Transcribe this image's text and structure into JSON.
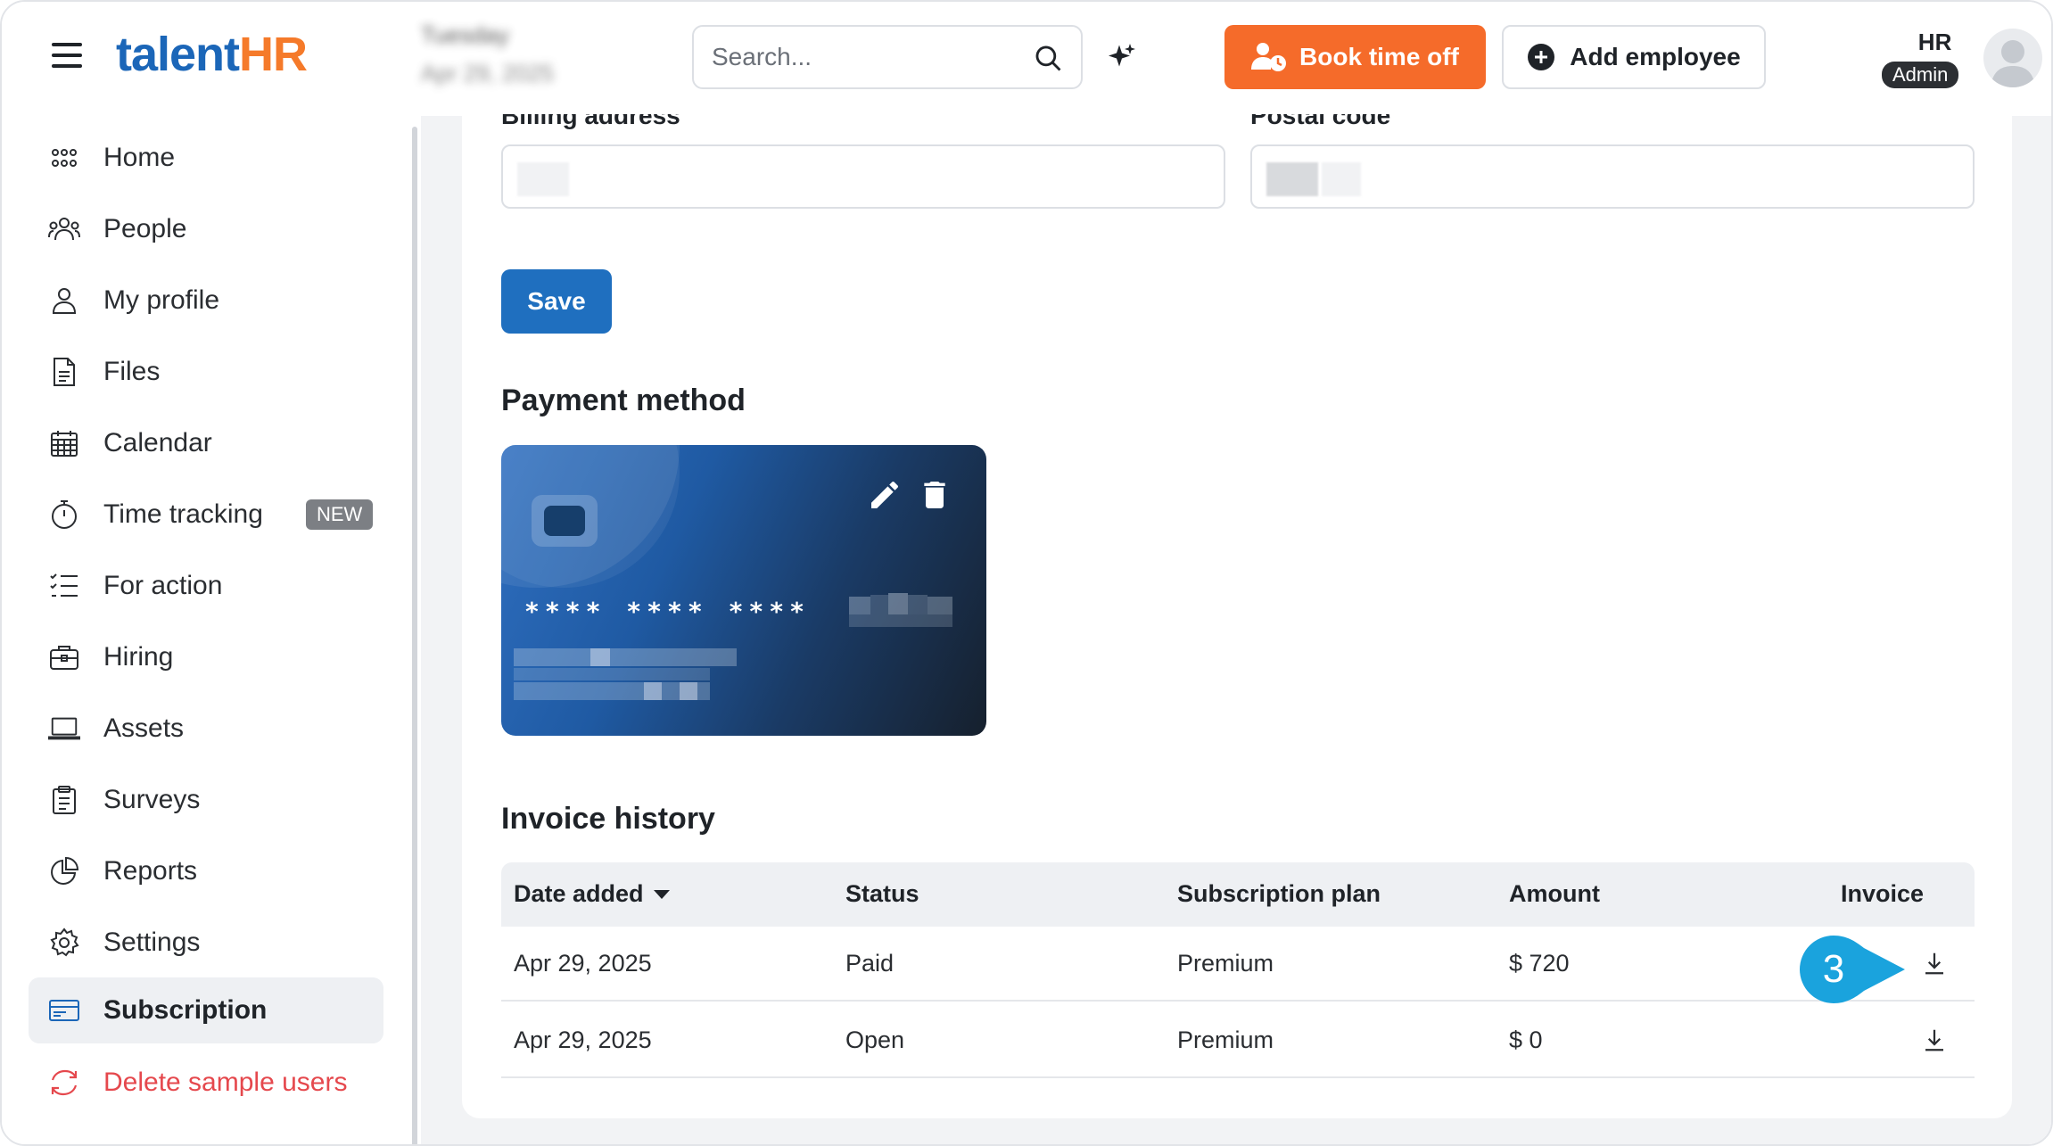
{
  "header": {
    "logo_talent": "talent",
    "logo_hr": "HR",
    "date_day": "Tuesday",
    "date_full": "Apr 29, 2025",
    "search_placeholder": "Search...",
    "book_time_off": "Book time off",
    "add_employee": "Add employee",
    "user_name": "HR",
    "user_role": "Admin"
  },
  "sidebar": {
    "items": [
      {
        "label": "Home",
        "icon": "grid-icon"
      },
      {
        "label": "People",
        "icon": "people-icon"
      },
      {
        "label": "My profile",
        "icon": "user-icon"
      },
      {
        "label": "Files",
        "icon": "file-icon"
      },
      {
        "label": "Calendar",
        "icon": "calendar-icon"
      },
      {
        "label": "Time tracking",
        "icon": "stopwatch-icon",
        "badge": "NEW"
      },
      {
        "label": "For action",
        "icon": "checklist-icon"
      },
      {
        "label": "Hiring",
        "icon": "briefcase-icon"
      },
      {
        "label": "Assets",
        "icon": "laptop-icon"
      },
      {
        "label": "Surveys",
        "icon": "clipboard-icon"
      },
      {
        "label": "Reports",
        "icon": "pie-chart-icon"
      },
      {
        "label": "Settings",
        "icon": "gear-icon"
      },
      {
        "label": "Subscription",
        "icon": "credit-card-icon",
        "active": true
      },
      {
        "label": "Delete sample users",
        "icon": "sync-icon",
        "danger": true
      }
    ]
  },
  "billing": {
    "address_label": "Billing address",
    "postal_label": "Postal code",
    "save_label": "Save"
  },
  "payment": {
    "title": "Payment method",
    "card_number_masked": "**** **** ****"
  },
  "invoices": {
    "title": "Invoice history",
    "columns": [
      "Date added",
      "Status",
      "Subscription plan",
      "Amount",
      "Invoice"
    ],
    "rows": [
      {
        "date": "Apr 29, 2025",
        "status": "Paid",
        "plan": "Premium",
        "amount": "$ 720"
      },
      {
        "date": "Apr 29, 2025",
        "status": "Open",
        "plan": "Premium",
        "amount": "$ 0"
      }
    ]
  },
  "callout": {
    "number": "3"
  },
  "colors": {
    "brand_blue": "#1b66b8",
    "brand_orange": "#f57a2a",
    "save_blue": "#1f6fbf",
    "callout_blue": "#1aa3dd",
    "danger": "#e5484d"
  }
}
